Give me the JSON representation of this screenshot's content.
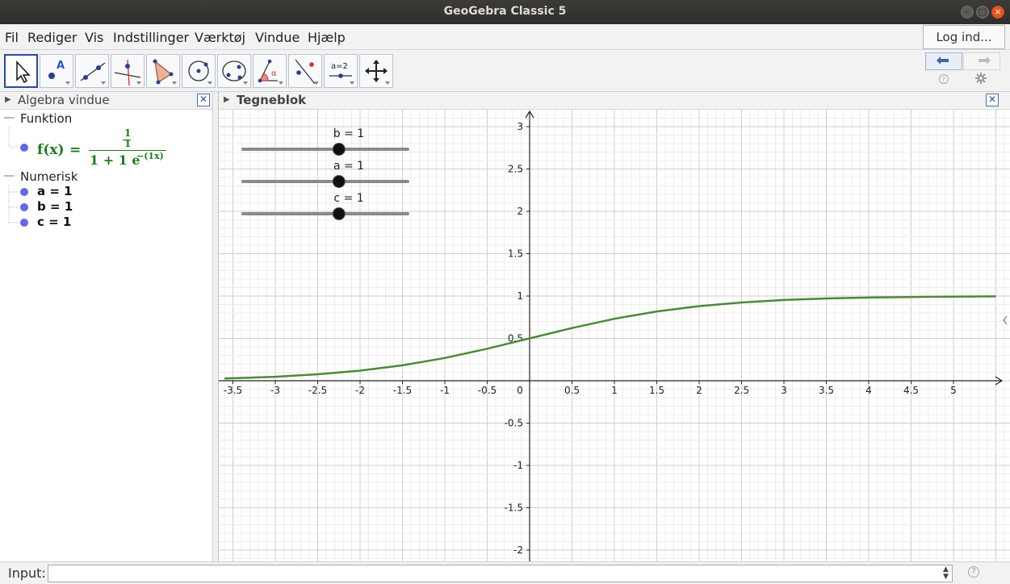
{
  "window": {
    "title": "GeoGebra Classic 5"
  },
  "menu": {
    "items": [
      "Fil",
      "Rediger",
      "Vis",
      "Indstillinger",
      "Værktøj",
      "Vindue",
      "Hjælp"
    ],
    "login_label": "Log ind..."
  },
  "toolbar": {
    "tools": [
      "move-tool",
      "point-tool",
      "line-tool",
      "perpendicular-line-tool",
      "polygon-tool",
      "circle-tool",
      "conic-tool",
      "angle-tool",
      "reflect-tool",
      "slider-tool",
      "move-graphics-view-tool"
    ],
    "slider_tool_text": "a=2",
    "point_tool_text": "A",
    "angle_tool_text": "α"
  },
  "algebra": {
    "title": "Algebra vindue",
    "group_function": "Funktion",
    "function": {
      "lhs": "f(x)",
      "equals": "=",
      "num_top": "1",
      "num_bottom": "1",
      "den_base": "1 + 1 e",
      "den_exp": "−(1x)"
    },
    "group_numeric": "Numerisk",
    "numerics": [
      "a = 1",
      "b = 1",
      "c = 1"
    ]
  },
  "graphics": {
    "title": "Tegneblok",
    "curve_color": "#4a8a3a",
    "sliders": [
      {
        "label": "b = 1",
        "value": 1,
        "min": -5,
        "max": 5
      },
      {
        "label": "a = 1",
        "value": 1,
        "min": -5,
        "max": 5
      },
      {
        "label": "c = 1",
        "value": 1,
        "min": -5,
        "max": 5
      }
    ]
  },
  "input_bar": {
    "label": "Input:",
    "value": ""
  },
  "chart_data": {
    "type": "line",
    "title": "",
    "xlabel": "",
    "ylabel": "",
    "xlim": [
      -3.6,
      5.55
    ],
    "ylim": [
      -2.1,
      3.2
    ],
    "grid": true,
    "x_ticks": [
      "-3.5",
      "-3",
      "-2.5",
      "-2",
      "-1.5",
      "-1",
      "-0.5",
      "0",
      "0.5",
      "1",
      "1.5",
      "2",
      "2.5",
      "3",
      "3.5",
      "4",
      "4.5",
      "5"
    ],
    "y_ticks": [
      "3",
      "2.5",
      "2",
      "1.5",
      "1",
      "0.5",
      "-0.5",
      "-1",
      "-1.5",
      "-2"
    ],
    "series": [
      {
        "x": [
          -3.6,
          -3,
          -2.5,
          -2,
          -1.5,
          -1,
          -0.5,
          0,
          0.5,
          1,
          1.5,
          2,
          2.5,
          3,
          3.5,
          4,
          4.5,
          5,
          5.5
        ],
        "y": [
          0.027,
          0.047,
          0.076,
          0.119,
          0.182,
          0.269,
          0.378,
          0.5,
          0.622,
          0.731,
          0.818,
          0.881,
          0.924,
          0.953,
          0.971,
          0.982,
          0.989,
          0.993,
          0.996
        ]
      }
    ]
  }
}
